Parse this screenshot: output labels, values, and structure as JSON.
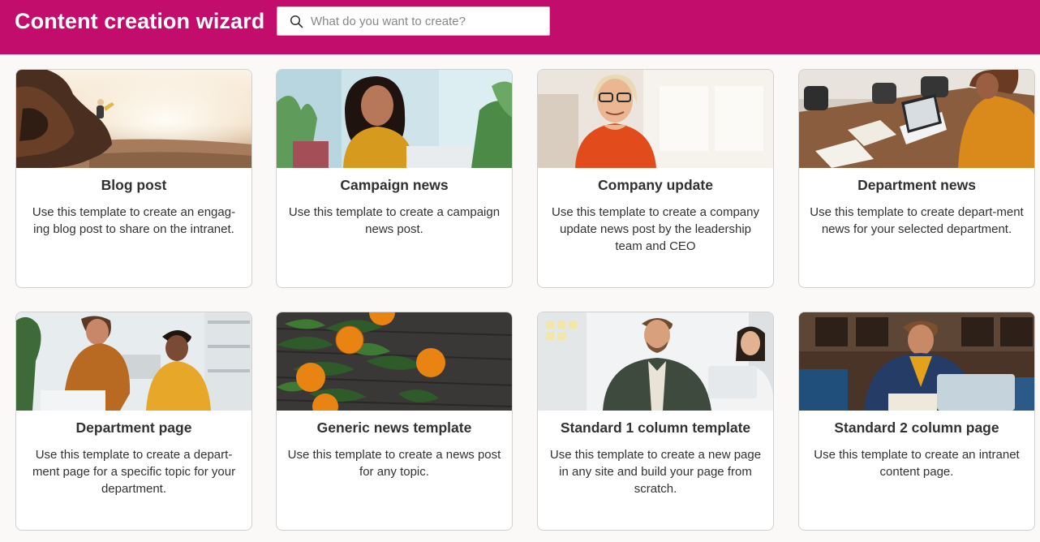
{
  "header": {
    "title": "Content creation wizard",
    "search_placeholder": "What do you want to create?",
    "search_value": "",
    "brand_color": "#c20d6c"
  },
  "cards": [
    {
      "title": "Blog post",
      "description": "Use this template to create an engag-ing blog post to share on the intranet.",
      "image": "cliff-climbers-sunset"
    },
    {
      "title": "Campaign news",
      "description": "Use this template to create a campaign news post.",
      "image": "woman-laptop-office"
    },
    {
      "title": "Company update",
      "description": "Use this template to create a company update news post by the leadership team and CEO",
      "image": "smiling-executive-woman"
    },
    {
      "title": "Department news",
      "description": "Use this template to create depart-ment news for your selected department.",
      "image": "desk-laptop-notes"
    },
    {
      "title": "Department page",
      "description": "Use this template to create a depart-ment page for a specific topic for your department.",
      "image": "two-colleagues-laptop"
    },
    {
      "title": "Generic news template",
      "description": "Use this template to create a news post for any topic.",
      "image": "oranges-on-wood"
    },
    {
      "title": "Standard 1 column template",
      "description": "Use this template to create a new page in any site and build your page from scratch.",
      "image": "smiling-team-meeting"
    },
    {
      "title": "Standard 2 column page",
      "description": "Use this template to create an intranet content page.",
      "image": "man-writing-laptop"
    }
  ]
}
